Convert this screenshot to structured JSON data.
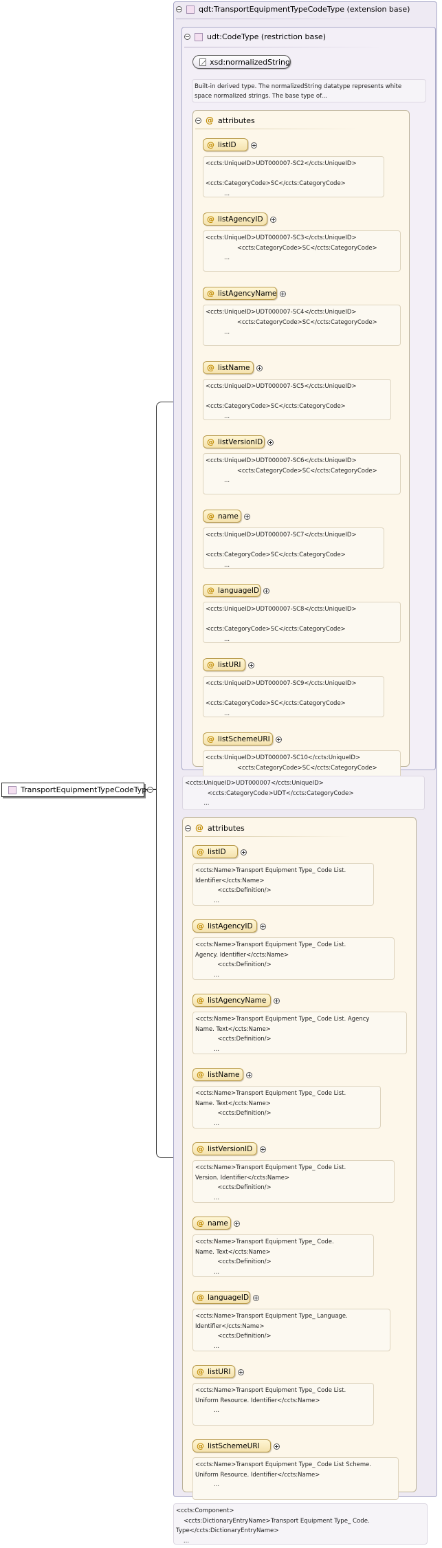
{
  "root": {
    "label": "TransportEquipmentTypeCodeType"
  },
  "extension": {
    "label": "qdt:TransportEquipmentTypeCodeType (extension base)"
  },
  "restriction": {
    "label": "udt:CodeType (restriction base)"
  },
  "normalized": {
    "label": "xsd:normalizedString",
    "doc": "Built-in derived type. The normalizedString datatype represents white\nspace normalized strings. The base type of..."
  },
  "inner_attributes": {
    "title": "attributes",
    "items": [
      {
        "name": "listID",
        "doc": "<ccts:UniqueID>UDT000007-SC2</ccts:UniqueID>\n\n<ccts:CategoryCode>SC</ccts:CategoryCode>\n          ..."
      },
      {
        "name": "listAgencyID",
        "doc": "<ccts:UniqueID>UDT000007-SC3</ccts:UniqueID>\n                 <ccts:CategoryCode>SC</ccts:CategoryCode>\n          ..."
      },
      {
        "name": "listAgencyName",
        "doc": "<ccts:UniqueID>UDT000007-SC4</ccts:UniqueID>\n                 <ccts:CategoryCode>SC</ccts:CategoryCode>\n          ..."
      },
      {
        "name": "listName",
        "doc": "<ccts:UniqueID>UDT000007-SC5</ccts:UniqueID>\n\n<ccts:CategoryCode>SC</ccts:CategoryCode>\n          ..."
      },
      {
        "name": "listVersionID",
        "doc": "<ccts:UniqueID>UDT000007-SC6</ccts:UniqueID>\n                 <ccts:CategoryCode>SC</ccts:CategoryCode>\n          ..."
      },
      {
        "name": "name",
        "doc": "<ccts:UniqueID>UDT000007-SC7</ccts:UniqueID>\n\n<ccts:CategoryCode>SC</ccts:CategoryCode>\n          ..."
      },
      {
        "name": "languageID",
        "doc": "<ccts:UniqueID>UDT000007-SC8</ccts:UniqueID>\n\n<ccts:CategoryCode>SC</ccts:CategoryCode>\n          ..."
      },
      {
        "name": "listURI",
        "doc": "<ccts:UniqueID>UDT000007-SC9</ccts:UniqueID>\n\n<ccts:CategoryCode>SC</ccts:CategoryCode>\n          ..."
      },
      {
        "name": "listSchemeURI",
        "doc": "<ccts:UniqueID>UDT000007-SC10</ccts:UniqueID>\n                 <ccts:CategoryCode>SC</ccts:CategoryCode>\n          ..."
      }
    ]
  },
  "udt_doc": "<ccts:UniqueID>UDT000007</ccts:UniqueID>\n            <ccts:CategoryCode>UDT</ccts:CategoryCode>\n          ...",
  "outer_attributes": {
    "title": "attributes",
    "items": [
      {
        "name": "listID",
        "doc": "<ccts:Name>Transport Equipment Type_ Code List.\nIdentifier</ccts:Name>\n            <ccts:Definition/>\n          ..."
      },
      {
        "name": "listAgencyID",
        "doc": "<ccts:Name>Transport Equipment Type_ Code List.\nAgency. Identifier</ccts:Name>\n            <ccts:Definition/>\n          ..."
      },
      {
        "name": "listAgencyName",
        "doc": "<ccts:Name>Transport Equipment Type_ Code List. Agency\nName. Text</ccts:Name>\n            <ccts:Definition/>\n          ..."
      },
      {
        "name": "listName",
        "doc": "<ccts:Name>Transport Equipment Type_ Code List.\nName. Text</ccts:Name>\n            <ccts:Definition/>\n          ..."
      },
      {
        "name": "listVersionID",
        "doc": "<ccts:Name>Transport Equipment Type_ Code List.\nVersion. Identifier</ccts:Name>\n            <ccts:Definition/>\n          ..."
      },
      {
        "name": "name",
        "doc": "<ccts:Name>Transport Equipment Type_ Code.\nName. Text</ccts:Name>\n            <ccts:Definition/>\n          ..."
      },
      {
        "name": "languageID",
        "doc": "<ccts:Name>Transport Equipment Type_ Language.\nIdentifier</ccts:Name>\n            <ccts:Definition/>\n          ..."
      },
      {
        "name": "listURI",
        "doc": "<ccts:Name>Transport Equipment Type_ Code List.\nUniform Resource. Identifier</ccts:Name>\n          ..."
      },
      {
        "name": "listSchemeURI",
        "doc": "<ccts:Name>Transport Equipment Type_ Code List Scheme.\nUniform Resource. Identifier</ccts:Name>\n          ..."
      }
    ]
  },
  "component_doc": "<ccts:Component>\n    <ccts:DictionaryEntryName>Transport Equipment Type_ Code.\nType</ccts:DictionaryEntryName>\n    ..."
}
